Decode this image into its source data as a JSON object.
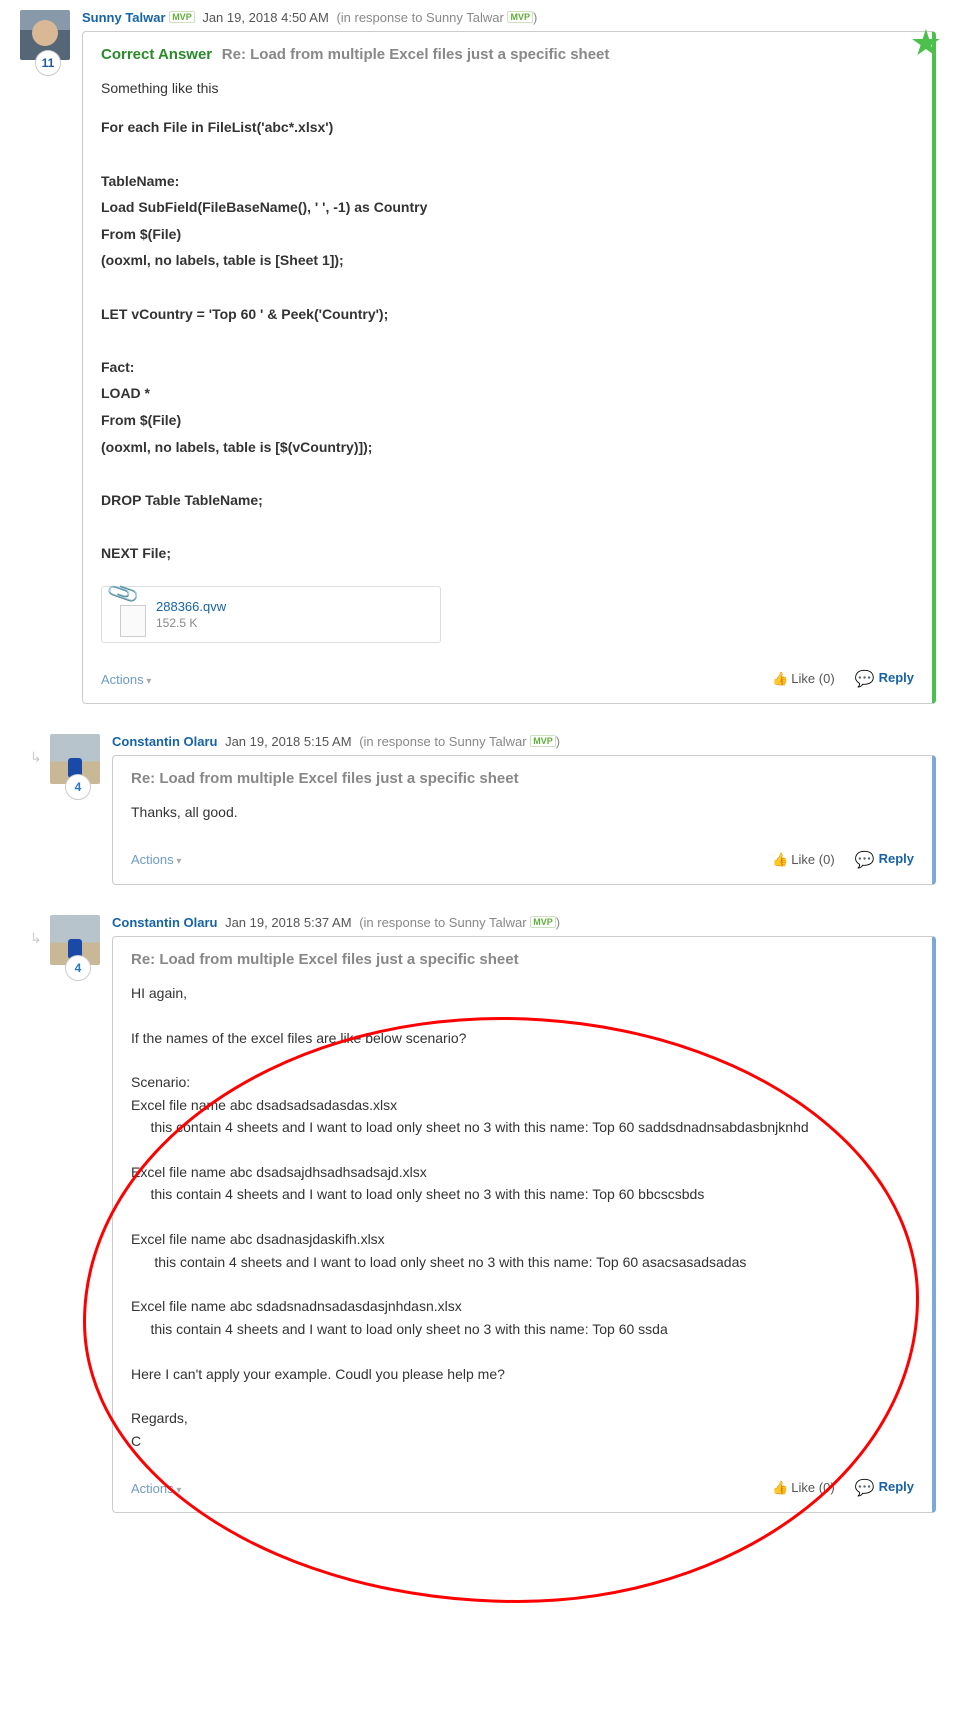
{
  "posts": [
    {
      "author": "Sunny Talwar",
      "mvp": true,
      "level": "11",
      "date": "Jan 19, 2018 4:50 AM",
      "in_response_to": "Sunny Talwar",
      "irt_mvp": true,
      "correct": true,
      "subject": "Re: Load from multiple Excel files just a specific sheet",
      "intro": "Something like this",
      "code": [
        "For each File in FileList('abc*.xlsx')",
        "",
        "TableName:",
        "Load SubField(FileBaseName(), ' ', -1) as Country",
        "From $(File)",
        "(ooxml, no labels, table is [Sheet 1]);",
        "",
        "LET vCountry = 'Top 60 ' & Peek('Country');",
        "",
        "Fact:",
        "LOAD *",
        "From $(File)",
        "(ooxml, no labels, table is [$(vCountry)]);",
        "",
        "DROP Table TableName;",
        "",
        "NEXT File;"
      ],
      "attachment": {
        "name": "288366.qvw",
        "size": "152.5 K"
      }
    },
    {
      "author": "Constantin Olaru",
      "mvp": false,
      "level": "4",
      "date": "Jan 19, 2018 5:15 AM",
      "in_response_to": "Sunny Talwar",
      "irt_mvp": true,
      "subject": "Re: Load from multiple Excel files just a specific sheet",
      "body": "Thanks, all good."
    },
    {
      "author": "Constantin Olaru",
      "mvp": false,
      "level": "4",
      "date": "Jan 19, 2018 5:37 AM",
      "in_response_to": "Sunny Talwar",
      "irt_mvp": true,
      "subject": "Re: Load from multiple Excel files just a specific sheet",
      "body_lines": [
        "HI again,",
        "",
        "If the names of the excel files are like below scenario?",
        "",
        "Scenario:",
        "Excel file name abc dsadsadsadasdas.xlsx",
        "     this contain 4 sheets and I want to load only sheet no 3 with this name: Top 60 saddsdnadnsabdasbnjknhd",
        "",
        "Excel file name abc dsadsajdhsadhsadsajd.xlsx",
        "     this contain 4 sheets and I want to load only sheet no 3 with this name: Top 60 bbcscsbds",
        "",
        "Excel file name abc dsadnasjdaskifh.xlsx",
        "      this contain 4 sheets and I want to load only sheet no 3 with this name: Top 60 asacsasadsadas",
        "",
        "Excel file name abc sdadsnadnsadasdasjnhdasn.xlsx",
        "     this contain 4 sheets and I want to load only sheet no 3 with this name: Top 60 ssda",
        "",
        "Here I can't apply your example. Coudl you please help me?",
        "",
        "Regards,",
        "C"
      ]
    }
  ],
  "ui": {
    "correct_answer": "Correct Answer",
    "actions": "Actions",
    "like": "Like",
    "reply": "Reply",
    "like_count": "(0)"
  }
}
